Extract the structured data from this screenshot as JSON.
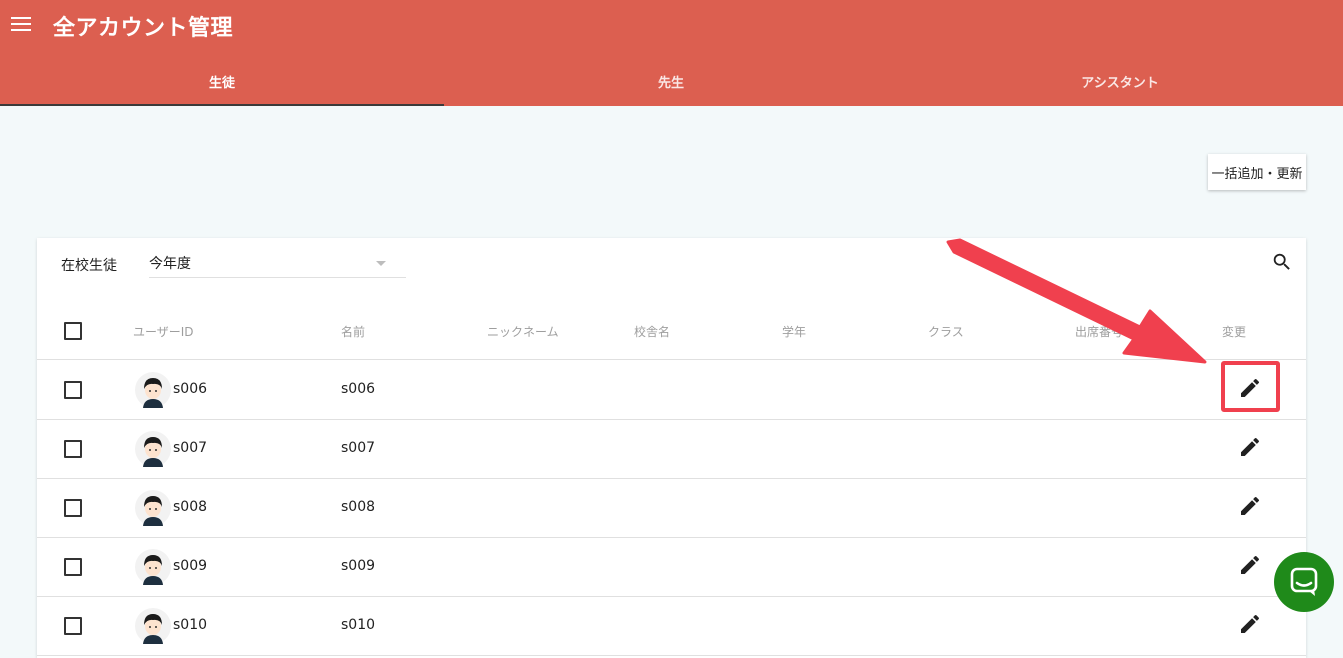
{
  "app": {
    "title": "全アカウント管理"
  },
  "tabs": [
    {
      "label": "生徒",
      "active": true
    },
    {
      "label": "先生",
      "active": false
    },
    {
      "label": "アシスタント",
      "active": false
    }
  ],
  "toolbar": {
    "bulk_button_label": "一括追加・更新"
  },
  "filter": {
    "label": "在校生徒",
    "selected_value": "今年度"
  },
  "table": {
    "headers": {
      "user_id": "ユーザーID",
      "name": "名前",
      "nickname": "ニックネーム",
      "school": "校舎名",
      "grade": "学年",
      "class": "クラス",
      "attendance": "出席番号",
      "edit": "変更"
    },
    "rows": [
      {
        "user_id": "s006",
        "name": "s006"
      },
      {
        "user_id": "s007",
        "name": "s007"
      },
      {
        "user_id": "s008",
        "name": "s008"
      },
      {
        "user_id": "s009",
        "name": "s009"
      },
      {
        "user_id": "s010",
        "name": "s010"
      }
    ]
  },
  "colors": {
    "appbar": "#dc5f50",
    "background": "#f3f9fa",
    "annotation": "#f0404e",
    "chat": "#1f8a1a"
  },
  "icons": [
    "menu-icon",
    "search-icon",
    "edit-icon",
    "chat-icon",
    "avatar"
  ]
}
